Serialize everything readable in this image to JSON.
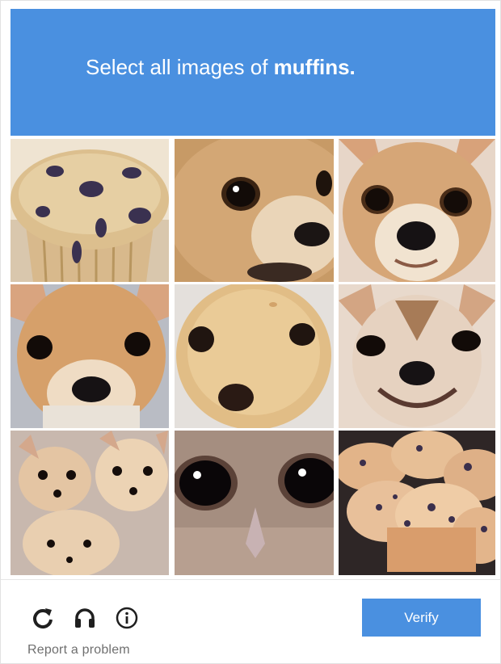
{
  "challenge": {
    "prompt_prefix": "Select all images of ",
    "prompt_target": "muffins.",
    "header_color": "#4a90e0"
  },
  "tiles": [
    {
      "subject": "blueberry muffin"
    },
    {
      "subject": "chihuahua"
    },
    {
      "subject": "chihuahua"
    },
    {
      "subject": "chihuahua"
    },
    {
      "subject": "blueberry muffin"
    },
    {
      "subject": "chihuahua"
    },
    {
      "subject": "chihuahua puppies"
    },
    {
      "subject": "owl"
    },
    {
      "subject": "blueberry muffins"
    }
  ],
  "toolbar": {
    "reload_icon": "reload-icon",
    "audio_icon": "headphones-icon",
    "info_icon": "info-icon"
  },
  "verify_label": "Verify",
  "report_label": "Report a problem"
}
